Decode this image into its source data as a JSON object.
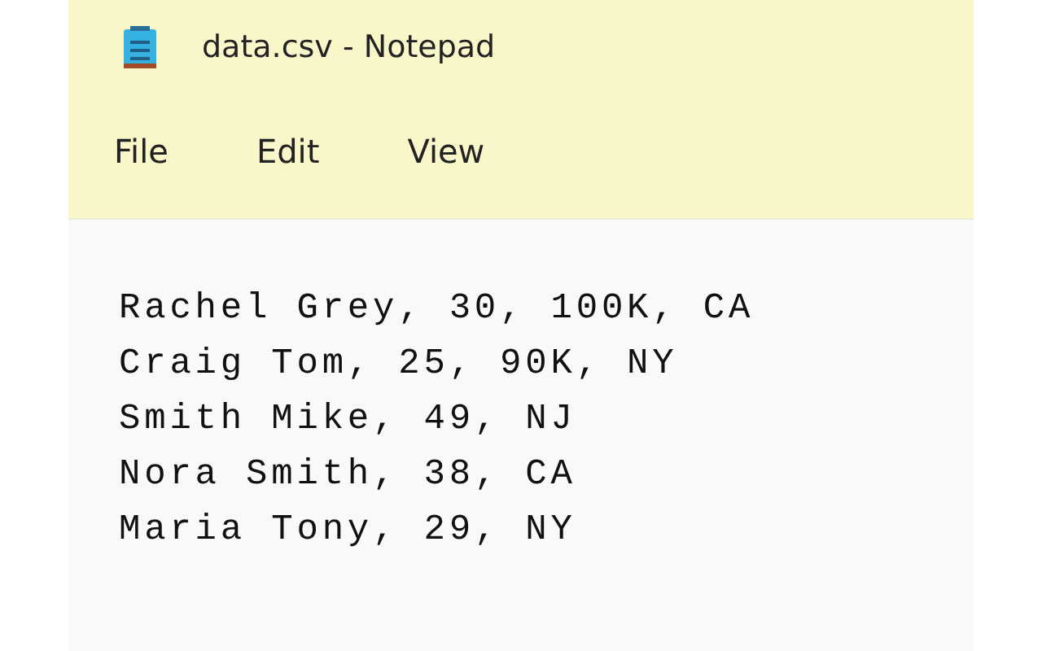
{
  "window": {
    "title": "data.csv - Notepad"
  },
  "menu": [
    {
      "label": "File"
    },
    {
      "label": "Edit"
    },
    {
      "label": "View"
    }
  ],
  "document": {
    "lines": [
      "Rachel Grey, 30, 100K, CA",
      "Craig Tom, 25, 90K, NY",
      "Smith Mike, 49, NJ",
      "Nora Smith, 38, CA",
      "Maria Tony, 29, NY"
    ]
  }
}
